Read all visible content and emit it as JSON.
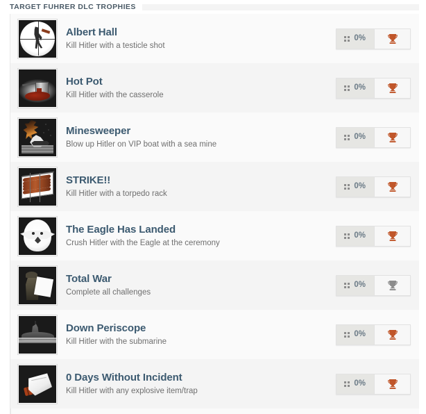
{
  "section": {
    "title": "TARGET FUHRER DLC TROPHIES"
  },
  "colors": {
    "title_text": "#3c5a70",
    "desc_text": "#6f6f6f",
    "header_text": "#4a5a66",
    "bronze_trophy": "#c0562a",
    "silver_trophy": "#8c8c8c",
    "row_odd_bg": "#fafafa",
    "row_even_bg": "#f4f4f4",
    "progress_bg": "#e6e6e3",
    "percent_text": "#6a7a86"
  },
  "badge": {
    "grid_icon": "grid-dots-icon",
    "trophy_icon": "trophy-icon"
  },
  "trophies": [
    {
      "name": "Albert Hall",
      "description": "Kill Hitler with a testicle shot",
      "progress": "0%",
      "trophy_tier": "bronze",
      "thumbnail": "sniper-scope-hanging-figure-art"
    },
    {
      "name": "Hot Pot",
      "description": "Kill Hitler with the casserole",
      "progress": "0%",
      "trophy_tier": "bronze",
      "thumbnail": "spilled-casserole-pot-art"
    },
    {
      "name": "Minesweeper",
      "description": "Blow up Hitler on VIP boat with a sea mine",
      "progress": "0%",
      "trophy_tier": "bronze",
      "thumbnail": "boat-explosion-sea-mine-art"
    },
    {
      "name": "STRIKE!!",
      "description": "Kill Hitler with a torpedo rack",
      "progress": "0%",
      "trophy_tier": "bronze",
      "thumbnail": "torpedo-rack-art"
    },
    {
      "name": "The Eagle Has Landed",
      "description": "Crush Hitler with the Eagle at the ceremony",
      "progress": "0%",
      "trophy_tier": "bronze",
      "thumbnail": "eagle-statue-art"
    },
    {
      "name": "Total War",
      "description": "Complete all challenges",
      "progress": "0%",
      "trophy_tier": "silver",
      "thumbnail": "soldier-with-map-art"
    },
    {
      "name": "Down Periscope",
      "description": "Kill Hitler with the submarine",
      "progress": "0%",
      "trophy_tier": "bronze",
      "thumbnail": "submarine-surfacing-art"
    },
    {
      "name": "0 Days Without Incident",
      "description": "Kill Hitler with any explosive item/trap",
      "progress": "0%",
      "trophy_tier": "bronze",
      "thumbnail": "explosive-in-satchel-art"
    }
  ]
}
